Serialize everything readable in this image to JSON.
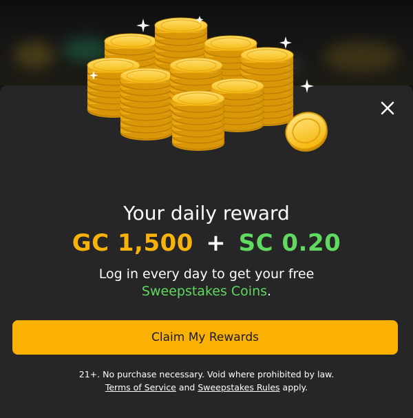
{
  "modal": {
    "title": "Your daily reward",
    "reward": {
      "gc_amount": "GC 1,500",
      "plus": "+",
      "sc_amount": "SC 0.20"
    },
    "description": {
      "line1": "Log in every day to get your free",
      "link": "Sweepstakes Coins",
      "suffix": "."
    },
    "claim_button": "Claim My Rewards",
    "legal": {
      "line1": "21+. No purchase necessary. Void where prohibited by law.",
      "terms_link": "Terms of Service",
      "and": " and ",
      "rules_link": "Sweepstakes Rules",
      "apply": " apply."
    },
    "icons": {
      "close": "close-icon",
      "illustration": "gold-coins-stack-icon"
    }
  },
  "colors": {
    "modal_bg": "#262626",
    "gold": "#f8b30a",
    "green": "#5fd95f",
    "button_bg": "#fbb101"
  }
}
